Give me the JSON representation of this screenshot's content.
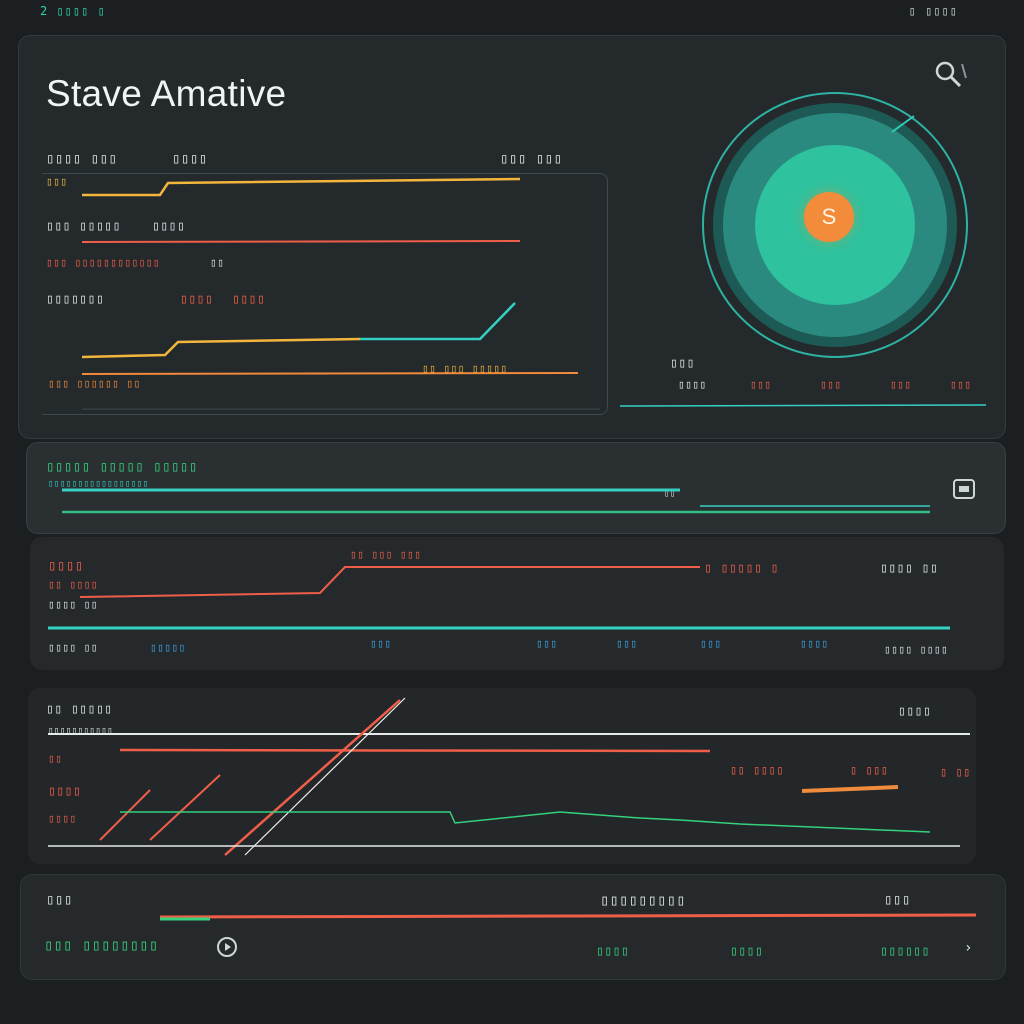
{
  "top_bar": {
    "left": "2 ▯▯▯▯ ▯",
    "right": "▯ ▯▯▯▯"
  },
  "header": {
    "title": "Stave Amative"
  },
  "main": {
    "rows": [
      {
        "label": "▯▯▯▯ ▯▯▯",
        "label2": "▯▯▯▯",
        "right": "▯▯▯ ▯▯▯",
        "sub": "▯▯▯"
      },
      {
        "label": "▯▯▯ ▯▯▯▯▯",
        "label2": "▯▯▯▯",
        "sub": "▯▯▯ ▯▯▯▯▯▯▯▯▯▯▯▯",
        "sub2": "▯▯"
      },
      {
        "label": "▯▯▯▯▯▯▯",
        "label2": "▯▯▯▯",
        "label3": "▯▯▯▯"
      },
      {
        "label": "▯▯▯ ▯▯▯▯▯▯ ▯▯",
        "right": "▯▯ ▯▯▯ ▯▯▯▯▯"
      }
    ],
    "legend": [
      {
        "label": "▯▯▯▯",
        "color": "#e9edee"
      },
      {
        "label": "▯▯▯",
        "color": "#ef5e48"
      },
      {
        "label": "▯▯▯",
        "color": "#ef5e48"
      },
      {
        "label": "▯▯▯",
        "color": "#ef5e48"
      },
      {
        "label": "▯▯▯",
        "color": "#ef5e48"
      }
    ],
    "gauge": {
      "badge": "S",
      "label": "▯▯▯"
    }
  },
  "stream": {
    "title": "▯▯▯▯▯ ▯▯▯▯▯ ▯▯▯▯▯",
    "sub": "▯▯▯▯▯▯▯▯▯▯▯▯▯▯▯▯▯",
    "end": "▯▯"
  },
  "rate": {
    "title": "▯▯▯▯",
    "sub": "▯▯ ▯▯▯▯",
    "top": "▯▯ ▯▯▯ ▯▯▯",
    "mid": "▯ ▯▯▯▯▯ ▯",
    "right": "▯▯▯▯ ▯▯",
    "left_axis": "▯▯▯▯ ▯▯",
    "bottom": [
      "▯▯▯▯ ▯▯",
      "▯▯▯▯▯",
      "▯▯▯",
      "▯▯▯",
      "▯▯▯",
      "▯▯▯",
      "▯▯▯▯",
      "▯▯▯▯ ▯▯▯▯"
    ]
  },
  "trend": {
    "title": "▯▯ ▯▯▯▯▯",
    "subtitle": "▯▯▯▯▯▯▯▯▯▯▯",
    "right": "▯▯▯▯",
    "axis_a": "▯▯",
    "axis_b": "▯▯▯▯",
    "axis_c": "▯▯▯▯",
    "scale": [
      "▯▯ ▯▯▯▯",
      "▯ ▯▯▯",
      "▯ ▯▯"
    ]
  },
  "footer": {
    "title": "▯▯▯",
    "mid": "▯▯▯▯▯▯▯▯▯",
    "right": "▯▯▯",
    "status": "▯▯▯ ▯▯▯▯▯▯▯▯",
    "values": [
      "▯▯▯▯",
      "▯▯▯▯",
      "▯▯▯▯▯▯"
    ]
  },
  "colors": {
    "teal": "#2fcab8",
    "orange": "#f28b3a",
    "red": "#ef5e48",
    "yellow": "#f2b63c",
    "green": "#35d17d"
  }
}
